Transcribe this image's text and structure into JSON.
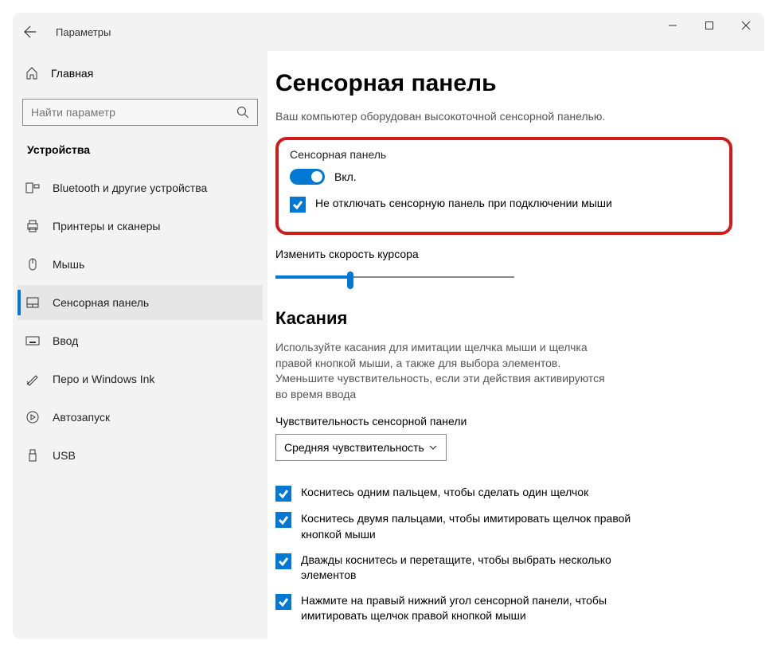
{
  "window": {
    "title": "Параметры"
  },
  "search": {
    "placeholder": "Найти параметр"
  },
  "home": "Главная",
  "section": "Устройства",
  "nav": [
    "Bluetooth и другие устройства",
    "Принтеры и сканеры",
    "Мышь",
    "Сенсорная панель",
    "Ввод",
    "Перо и Windows Ink",
    "Автозапуск",
    "USB"
  ],
  "page": {
    "title": "Сенсорная панель",
    "desc": "Ваш компьютер оборудован высокоточной сенсорной панелью.",
    "toggle_group": "Сенсорная панель",
    "toggle_state": "Вкл.",
    "keep_on_mouse": "Не отключать сенсорную панель при подключении мыши",
    "cursor_speed": "Изменить скорость курсора",
    "touches_h": "Касания",
    "touches_desc": "Используйте касания для имитации щелчка мыши и щелчка правой кнопкой мыши, а также для выбора элементов. Уменьшите чувствительность, если эти действия активируются во время ввода",
    "sensitivity_label": "Чувствительность сенсорной панели",
    "sensitivity_value": "Средняя чувствительность",
    "opts": [
      "Коснитесь одним пальцем, чтобы сделать один щелчок",
      "Коснитесь двумя пальцами, чтобы имитировать щелчок правой кнопкой мыши",
      "Дважды коснитесь и перетащите, чтобы выбрать несколько элементов",
      "Нажмите на правый нижний угол сенсорной панели, чтобы имитировать щелчок правой кнопкой мыши"
    ]
  }
}
